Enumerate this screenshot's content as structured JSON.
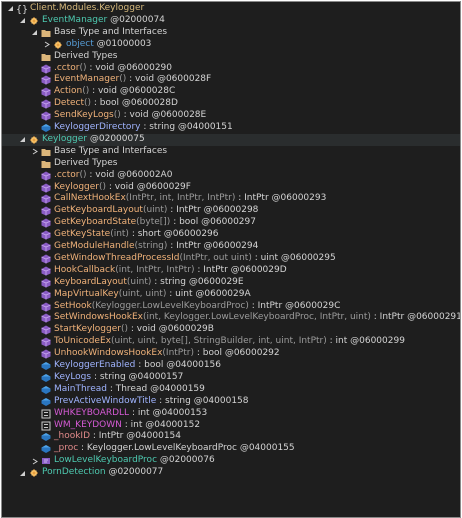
{
  "tree": {
    "namespace": "Client.Modules.Keylogger",
    "event_manager": {
      "name": "EventManager",
      "token": " @02000074",
      "base_types_label": "Base Type and Interfaces",
      "base_object": "object",
      "base_object_token": " @01000003",
      "derived_types_label": "Derived Types",
      "members": [
        {
          "name": ".cctor",
          "sig": "()",
          "ret": " : void",
          "token": " @06000290"
        },
        {
          "name": "EventManager",
          "sig": "()",
          "ret": " : void",
          "token": " @0600028F"
        },
        {
          "name": "Action",
          "sig": "()",
          "ret": " : void",
          "token": " @0600028C"
        },
        {
          "name": "Detect",
          "sig": "()",
          "ret": " : bool",
          "token": " @0600028D"
        },
        {
          "name": "SendKeyLogs",
          "sig": "()",
          "ret": " : void",
          "token": " @0600028E"
        },
        {
          "name": "KeyloggerDirectory",
          "sig": "",
          "ret": " : string",
          "token": " @04000151"
        }
      ]
    },
    "keylogger": {
      "name": "Keylogger",
      "token": " @02000075",
      "base_types_label": "Base Type and Interfaces",
      "derived_types_label": "Derived Types",
      "members": [
        {
          "name": ".cctor",
          "sig": "()",
          "ret": " : void",
          "token": " @060002A0"
        },
        {
          "name": "Keylogger",
          "sig": "()",
          "ret": " : void",
          "token": " @0600029F"
        },
        {
          "name": "CallNextHookEx",
          "sig": "(IntPtr, int, IntPtr, IntPtr)",
          "ret": " : IntPtr",
          "token": " @06000293"
        },
        {
          "name": "GetKeyboardLayout",
          "sig": "(uint)",
          "ret": " : IntPtr",
          "token": " @06000298"
        },
        {
          "name": "GetKeyboardState",
          "sig": "(byte[])",
          "ret": " : bool",
          "token": " @06000297"
        },
        {
          "name": "GetKeyState",
          "sig": "(int)",
          "ret": " : short",
          "token": " @06000296"
        },
        {
          "name": "GetModuleHandle",
          "sig": "(string)",
          "ret": " : IntPtr",
          "token": " @06000294"
        },
        {
          "name": "GetWindowThreadProcessId",
          "sig": "(IntPtr, out uint)",
          "ret": " : uint",
          "token": " @06000295"
        },
        {
          "name": "HookCallback",
          "sig": "(int, IntPtr, IntPtr)",
          "ret": " : IntPtr",
          "token": " @0600029D"
        },
        {
          "name": "KeyboardLayout",
          "sig": "(uint)",
          "ret": " : string",
          "token": " @0600029E"
        },
        {
          "name": "MapVirtualKey",
          "sig": "(uint, uint)",
          "ret": " : uint",
          "token": " @0600029A"
        },
        {
          "name": "SetHook",
          "sig": "(Keylogger.LowLevelKeyboardProc)",
          "ret": " : IntPtr",
          "token": " @0600029C"
        },
        {
          "name": "SetWindowsHookEx",
          "sig": "(int, Keylogger.LowLevelKeyboardProc, IntPtr, uint)",
          "ret": " : IntPtr",
          "token": " @06000291"
        },
        {
          "name": "StartKeylogger",
          "sig": "()",
          "ret": " : void",
          "token": " @0600029B"
        },
        {
          "name": "ToUnicodeEx",
          "sig": "(uint, uint, byte[], StringBuilder, int, uint, IntPtr)",
          "ret": " : int",
          "token": " @06000299"
        },
        {
          "name": "UnhookWindowsHookEx",
          "sig": "(IntPtr)",
          "ret": " : bool",
          "token": " @06000292"
        }
      ],
      "fields": [
        {
          "name": "KeyloggerEnabled",
          "ret": " : bool",
          "token": " @04000156"
        },
        {
          "name": "KeyLogs",
          "ret": " : string",
          "token": " @04000157"
        },
        {
          "name": "MainThread",
          "ret": " : Thread",
          "token": " @04000159"
        },
        {
          "name": "PrevActiveWindowTitle",
          "ret": " : string",
          "token": " @04000158"
        },
        {
          "name": "WHKEYBOARDLL",
          "ret": " : int",
          "token": " @04000153"
        },
        {
          "name": "WM_KEYDOWN",
          "ret": " : int",
          "token": " @04000152"
        },
        {
          "name": "_hookID",
          "ret": " : IntPtr",
          "token": " @04000154"
        },
        {
          "name": "_proc",
          "ret": " : Keylogger.LowLevelKeyboardProc",
          "token": " @04000155"
        }
      ],
      "nested": {
        "name": "LowLevelKeyboardProc",
        "token": " @02000076"
      }
    },
    "porn_detection": {
      "name": "PornDetection",
      "token": " @02000077"
    }
  },
  "colors": {
    "background": "#1e1e1e",
    "method": "#f0b27a",
    "field": "#a0b4ff",
    "const": "#d45ad4",
    "type": "#4ec9b0",
    "keyword": "#569cd6"
  },
  "icons": {
    "namespace": "braces-icon",
    "class": "class-icon",
    "folder": "folder-icon",
    "method": "method-cube-icon",
    "field": "field-icon",
    "const": "constant-icon"
  }
}
